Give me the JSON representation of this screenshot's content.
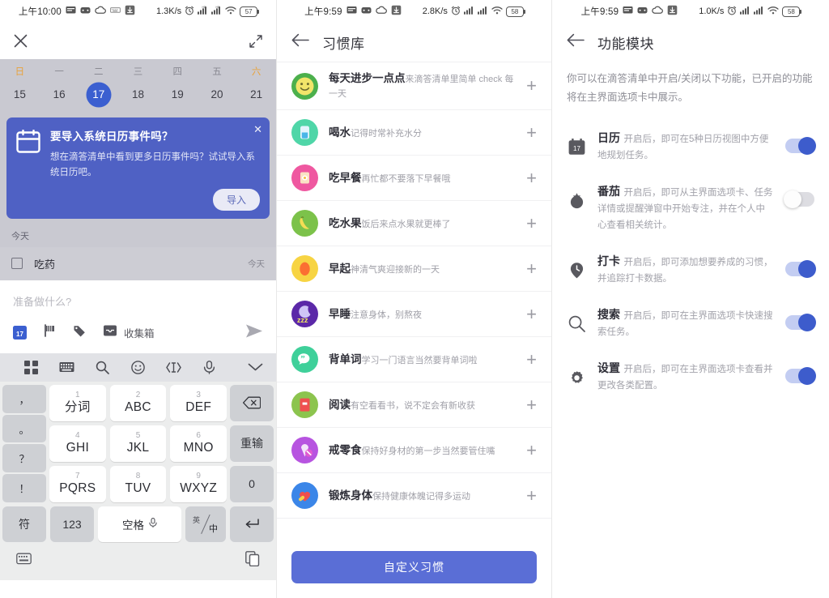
{
  "left": {
    "status": {
      "time": "上午10:00",
      "speed": "1.3K/s",
      "battery": "57"
    },
    "close_label": "✕",
    "calendar": {
      "weekday_names": [
        "日",
        "一",
        "二",
        "三",
        "四",
        "五",
        "六"
      ],
      "days": [
        "15",
        "16",
        "17",
        "18",
        "19",
        "20",
        "21"
      ],
      "selected_day": "17",
      "selected_color": "#3b5fd0"
    },
    "banner": {
      "title": "要导入系统日历事件吗？",
      "body": "想在滴答清单中看到更多日历事件吗？试试导入系统日历吧。",
      "import_label": "导入",
      "close_label": "✕",
      "bg_color": "#4f61c4"
    },
    "today_header": "今天",
    "task": {
      "name": "吃药",
      "due": "今天"
    },
    "composer": {
      "placeholder": "准备做什么?",
      "list_label": "收集箱",
      "date_chip": "17"
    },
    "keyboard": {
      "punctuation": [
        "，",
        "。",
        "？",
        "！"
      ],
      "keys": [
        {
          "num": "1",
          "alpha": "分词"
        },
        {
          "num": "2",
          "alpha": "ABC"
        },
        {
          "num": "3",
          "alpha": "DEF"
        },
        {
          "num": "4",
          "alpha": "GHI"
        },
        {
          "num": "5",
          "alpha": "JKL"
        },
        {
          "num": "6",
          "alpha": "MNO"
        },
        {
          "num": "7",
          "alpha": "PQRS"
        },
        {
          "num": "8",
          "alpha": "TUV"
        },
        {
          "num": "9",
          "alpha": "WXYZ"
        }
      ],
      "backspace": "⌫",
      "redo_label": "重输",
      "zero_label": "0",
      "symbol_label": "符",
      "num_label": "123",
      "space_label": "空格",
      "lang_en": "英",
      "lang_zh": "中",
      "enter_label": "↵"
    }
  },
  "mid": {
    "status": {
      "time": "上午9:59",
      "speed": "2.8K/s",
      "battery": "58"
    },
    "title": "习惯库",
    "custom_button": "自定义习惯",
    "habits": [
      {
        "name": "每天进步一点点",
        "desc": "来滴答清单里简单 check 每一天",
        "color": "#4cb04c",
        "inner": "#f2e56a",
        "glyph": "☺"
      },
      {
        "name": "喝水",
        "desc": "记得时常补充水分",
        "color": "#4fd6a8",
        "inner": "#d8effc",
        "glyph": "▯"
      },
      {
        "name": "吃早餐",
        "desc": "再忙都不要落下早餐哦",
        "color": "#ef58a0",
        "inner": "#fbe7c9",
        "glyph": "▣"
      },
      {
        "name": "吃水果",
        "desc": "饭后来点水果就更棒了",
        "color": "#7cc24a",
        "inner": "#f5dd55",
        "glyph": "🍌"
      },
      {
        "name": "早起",
        "desc": "神清气爽迎接新的一天",
        "color": "#f7d443",
        "inner": "#fb6f32",
        "glyph": "●"
      },
      {
        "name": "早睡",
        "desc": "注意身体，别熬夜",
        "color": "#5b28a8",
        "inner": "#9b8cf0",
        "glyph": "☾"
      },
      {
        "name": "背单词",
        "desc": "学习一门语言当然要背单词啦",
        "color": "#3fd09a",
        "inner": "#ffffff",
        "glyph": "❞"
      },
      {
        "name": "阅读",
        "desc": "有空看看书，说不定会有新收获",
        "color": "#8cc44e",
        "inner": "#ef5050",
        "glyph": "▤"
      },
      {
        "name": "戒零食",
        "desc": "保持好身材的第一步当然要管住嘴",
        "color": "#b754e0",
        "inner": "#f0e0f7",
        "glyph": "◓"
      },
      {
        "name": "锻炼身体",
        "desc": "保持健康体魄记得多运动",
        "color": "#3b86e8",
        "inner": "#f04e4e",
        "glyph": "♥"
      }
    ]
  },
  "right": {
    "status": {
      "time": "上午9:59",
      "speed": "1.0K/s",
      "battery": "58"
    },
    "title": "功能模块",
    "intro": "你可以在滴答清单中开启/关闭以下功能，已开启的功能将在主界面选项卡中展示。",
    "features": [
      {
        "name": "日历",
        "desc": "开启后，即可在5种日历视图中方便地规划任务。",
        "icon": "calendar-icon",
        "enabled": true
      },
      {
        "name": "番茄",
        "desc": "开启后，即可从主界面选项卡、任务详情或提醒弹窗中开始专注，并在个人中心查看相关统计。",
        "icon": "tomato-icon",
        "enabled": false
      },
      {
        "name": "打卡",
        "desc": "开启后，即可添加想要养成的习惯，并追踪打卡数据。",
        "icon": "clock-pin-icon",
        "enabled": true
      },
      {
        "name": "搜索",
        "desc": "开启后，即可在主界面选项卡快速搜索任务。",
        "icon": "search-icon",
        "enabled": true
      },
      {
        "name": "设置",
        "desc": "开启后，即可在主界面选项卡查看并更改各类配置。",
        "icon": "gear-icon",
        "enabled": true
      }
    ],
    "toggle_on_color": "#3d5ccc",
    "toggle_track_on": "#c3cdf2"
  }
}
